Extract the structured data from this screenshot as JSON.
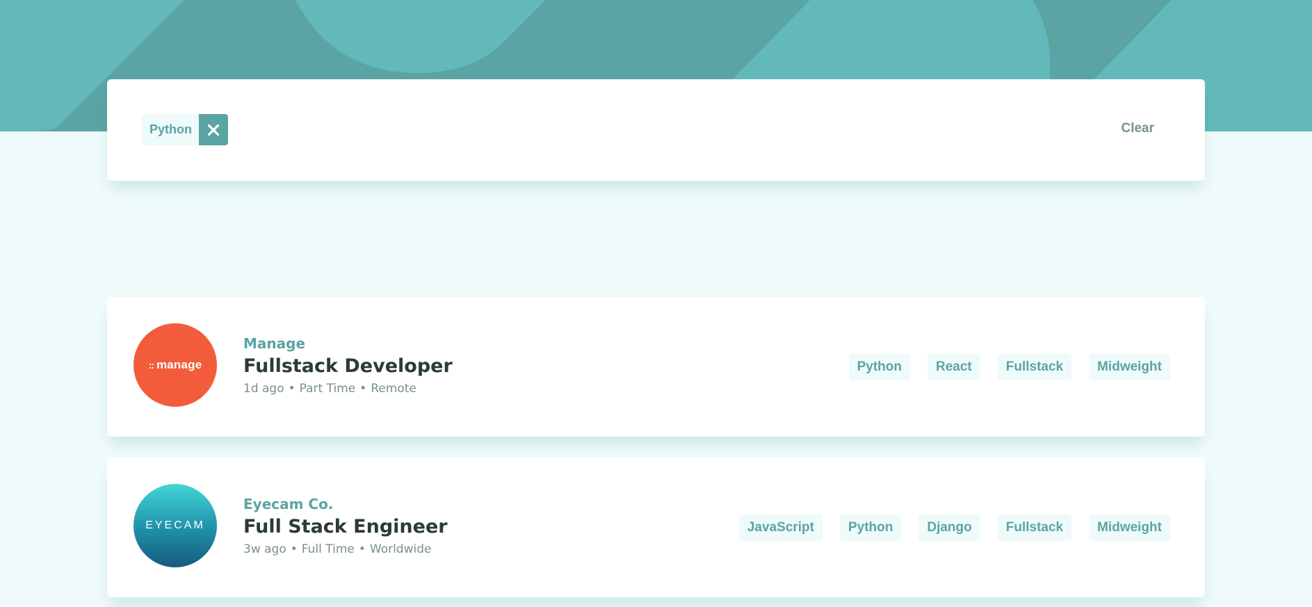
{
  "filter": {
    "chips": [
      {
        "label": "Python"
      }
    ],
    "clear_label": "Clear"
  },
  "jobs": [
    {
      "company": "Manage",
      "logo_text": "manage",
      "logo_color": "#f25c3b",
      "position": "Fullstack Developer",
      "posted_at": "1d ago",
      "contract": "Part Time",
      "location": "Remote",
      "tags": [
        "Python",
        "React",
        "Fullstack",
        "Midweight"
      ]
    },
    {
      "company": "Eyecam Co.",
      "logo_text": "EYECAM",
      "logo_color": "#2597b0",
      "position": "Full Stack Engineer",
      "posted_at": "3w ago",
      "contract": "Full Time",
      "location": "Worldwide",
      "tags": [
        "JavaScript",
        "Python",
        "Django",
        "Fullstack",
        "Midweight"
      ]
    }
  ],
  "colors": {
    "primary": "#5ba4a4",
    "background": "#effafa",
    "text_dark": "#2c3a3a",
    "text_muted": "#7b8e8e"
  }
}
